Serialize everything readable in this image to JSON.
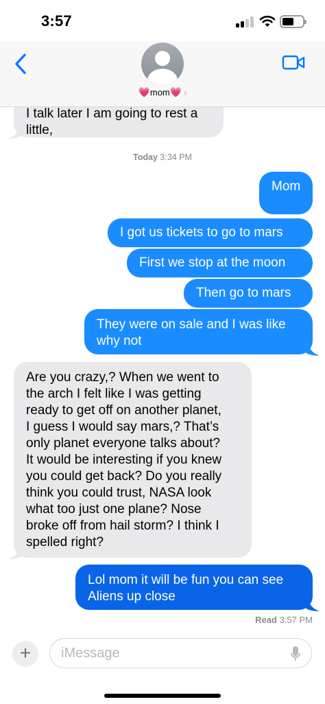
{
  "status_bar": {
    "time": "3:57",
    "signal_bars": 2,
    "battery_level": 0.45
  },
  "header": {
    "heart_left": "💗",
    "contact_name": "mom",
    "heart_right": "💗",
    "chevron": "›",
    "back_icon": "chevron-left-icon",
    "video_icon": "video-camera-icon"
  },
  "messages": [
    {
      "from": "them",
      "text": "I talk later I am going to rest a\nlittle,"
    },
    {
      "from": "me",
      "text": "Mom"
    },
    {
      "from": "me",
      "text": "I got us tickets to go to mars"
    },
    {
      "from": "me",
      "text": "First we stop at the moon"
    },
    {
      "from": "me",
      "text": "Then go to mars"
    },
    {
      "from": "me",
      "text": "They were on sale and I was like\nwhy not"
    },
    {
      "from": "them",
      "text": "Are you crazy,? When we went to\nthe arch I felt like I was getting\nready to get off on another planet,\nI guess I would say mars,? That’s\nonly planet everyone talks about?\nIt would be interesting if you knew\nyou could get back? Do you really\nthink you could trust, NASA look\nwhat too just one plane? Nose\nbroke off from hail storm? I think I\nspelled right?"
    },
    {
      "from": "me",
      "text": "Lol mom it will be fun you can see\nAliens up close"
    }
  ],
  "timestamp": {
    "day": "Today",
    "time": "3:34 PM"
  },
  "read_receipt": {
    "label": "Read",
    "time": "3:57 PM"
  },
  "composer": {
    "plus": "+",
    "placeholder": "iMessage"
  },
  "colors": {
    "outgoing": "#1a8cff",
    "incoming": "#e9e9eb",
    "accent": "#007aff"
  }
}
